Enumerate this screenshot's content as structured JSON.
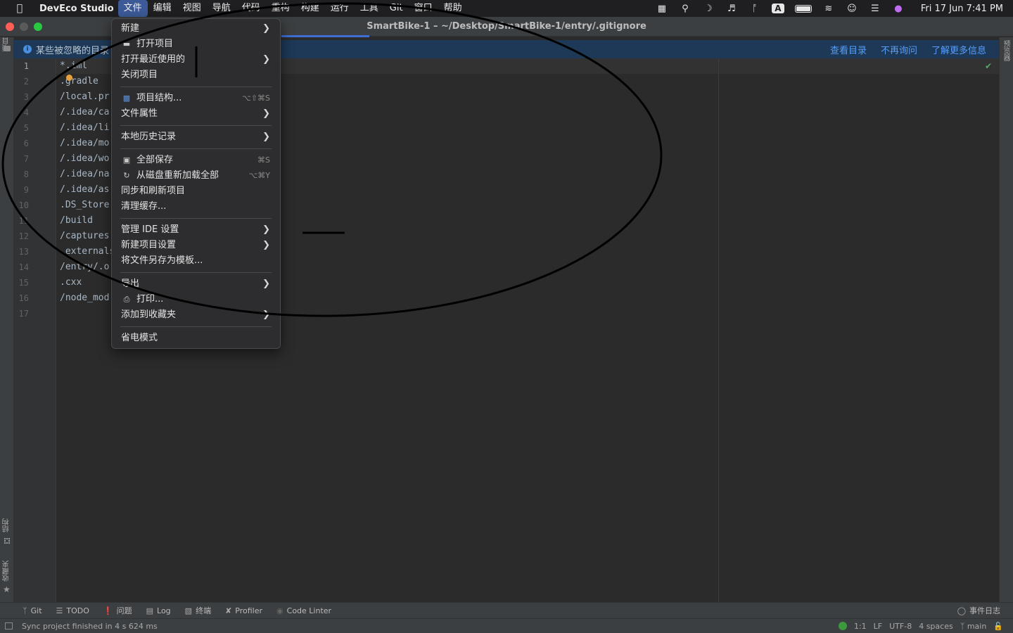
{
  "menubar": {
    "app_name": "DevEco Studio",
    "menus": [
      "文件",
      "编辑",
      "视图",
      "导航",
      "代码",
      "重构",
      "构建",
      "运行",
      "工具",
      "Git",
      "窗口",
      "帮助"
    ],
    "active_menu": "文件",
    "status_icons": [
      "stamp-icon",
      "search-icon",
      "moon-icon",
      "volume-icon",
      "bluetooth-icon",
      "input-source-icon",
      "battery-icon",
      "wifi-icon",
      "user-icon",
      "control-center-icon",
      "siri-icon"
    ],
    "input_source": "A",
    "clock": "Fri 17 Jun  7:41 PM"
  },
  "window": {
    "title": "SmartBike-1 – ~/Desktop/SmartBike-1/entry/.gitignore"
  },
  "notification": {
    "message": "某些被忽略的目录",
    "links": [
      "查看目录",
      "不再询问",
      "了解更多信息"
    ]
  },
  "editor": {
    "line_numbers": [
      "1",
      "2",
      "3",
      "4",
      "5",
      "6",
      "7",
      "8",
      "9",
      "10",
      "11",
      "12",
      "13",
      "14",
      "15",
      "16",
      "17"
    ],
    "lines": [
      "*.iml",
      ".gradle",
      "/local.pr",
      "/.idea/ca",
      "/.idea/li",
      "/.idea/mo",
      "/.idea/wo",
      "/.idea/na",
      "/.idea/as",
      ".DS_Store",
      "/build",
      "/captures",
      ".externals",
      "/entry/.o",
      ".cxx",
      "/node_mod",
      ""
    ]
  },
  "file_menu": {
    "items": [
      {
        "label": "新建",
        "icon": "",
        "arrow": true,
        "shortcut": ""
      },
      {
        "label": "打开项目",
        "icon": "folder-icon",
        "arrow": false,
        "shortcut": ""
      },
      {
        "label": "打开最近使用的",
        "icon": "",
        "arrow": true,
        "shortcut": ""
      },
      {
        "label": "关闭项目",
        "icon": "",
        "arrow": false,
        "shortcut": ""
      },
      {
        "label": "项目结构...",
        "icon": "project-structure-icon",
        "arrow": false,
        "shortcut": "⌥⇧⌘S"
      },
      {
        "label": "文件属性",
        "icon": "",
        "arrow": true,
        "shortcut": ""
      },
      {
        "label": "本地历史记录",
        "icon": "",
        "arrow": true,
        "shortcut": ""
      },
      {
        "label": "全部保存",
        "icon": "save-icon",
        "arrow": false,
        "shortcut": "⌘S"
      },
      {
        "label": "从磁盘重新加载全部",
        "icon": "reload-icon",
        "arrow": false,
        "shortcut": "⌥⌘Y"
      },
      {
        "label": "同步和刷新项目",
        "icon": "",
        "arrow": false,
        "shortcut": ""
      },
      {
        "label": "清理缓存...",
        "icon": "",
        "arrow": false,
        "shortcut": ""
      },
      {
        "label": "管理 IDE 设置",
        "icon": "",
        "arrow": true,
        "shortcut": ""
      },
      {
        "label": "新建项目设置",
        "icon": "",
        "arrow": true,
        "shortcut": ""
      },
      {
        "label": "将文件另存为模板...",
        "icon": "",
        "arrow": false,
        "shortcut": ""
      },
      {
        "label": "导出",
        "icon": "",
        "arrow": true,
        "shortcut": ""
      },
      {
        "label": "打印...",
        "icon": "print-icon",
        "arrow": false,
        "shortcut": ""
      },
      {
        "label": "添加到收藏夹",
        "icon": "",
        "arrow": true,
        "shortcut": ""
      },
      {
        "label": "省电模式",
        "icon": "",
        "arrow": false,
        "shortcut": ""
      }
    ]
  },
  "left_strip": {
    "top_label": "项目",
    "structure_label": "结构",
    "favorites_label": "收藏夹"
  },
  "right_strip": {
    "label": "预览器"
  },
  "bottom_tools": {
    "items": [
      "Git",
      "TODO",
      "问题",
      "Log",
      "终端",
      "Profiler",
      "Code Linter"
    ],
    "event_log": "事件日志"
  },
  "status": {
    "message": "Sync project finished in 4 s 624 ms",
    "position": "1:1",
    "line_sep": "LF",
    "encoding": "UTF-8",
    "indent": "4 spaces",
    "branch": "main"
  },
  "colors": {
    "menubar_bg": "#1f1f22",
    "active_menu": "#3d5a98",
    "notification_bg": "#1d3957",
    "link": "#589df6",
    "editor_bg": "#2b2b2b",
    "sync_ok": "#3c9a3c"
  }
}
